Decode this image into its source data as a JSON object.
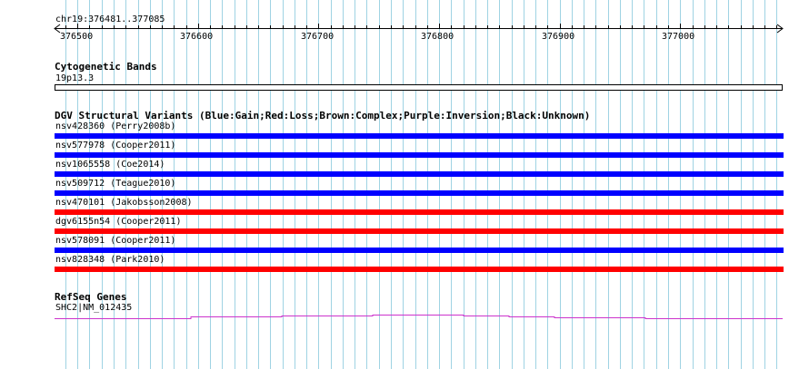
{
  "ruler": {
    "region_label": "chr19:376481..377085",
    "start": 376481,
    "end": 377085,
    "tick_labels": [
      "376500",
      "376600",
      "376700",
      "376800",
      "376900",
      "377000"
    ]
  },
  "tracks": {
    "cytobands": {
      "title": "Cytogenetic Bands",
      "band_label": "19p13.3"
    },
    "dgv": {
      "title": "DGV Structural Variants (Blue:Gain;Red:Loss;Brown:Complex;Purple:Inversion;Black:Unknown)",
      "variants": [
        {
          "label": "nsv428360 (Perry2008b)",
          "type": "gain",
          "color": "#0000ff"
        },
        {
          "label": "nsv577978 (Cooper2011)",
          "type": "gain",
          "color": "#0000ff"
        },
        {
          "label": "nsv1065558 (Coe2014)",
          "type": "gain",
          "color": "#0000ff"
        },
        {
          "label": "nsv509712 (Teague2010)",
          "type": "gain",
          "color": "#0000ff"
        },
        {
          "label": "nsv470101 (Jakobsson2008)",
          "type": "loss",
          "color": "#ff0000"
        },
        {
          "label": "dgv6155n54 (Cooper2011)",
          "type": "loss",
          "color": "#ff0000"
        },
        {
          "label": "nsv578091 (Cooper2011)",
          "type": "gain",
          "color": "#0000ff"
        },
        {
          "label": "nsv828348 (Park2010)",
          "type": "loss",
          "color": "#ff0000"
        }
      ]
    },
    "refseq": {
      "title": "RefSeq Genes",
      "gene_label": "SHC2|NM_012435",
      "gene_color": "#cc33cc"
    }
  },
  "colors": {
    "grid_line": "#9fd3e3",
    "gain": "#0000ff",
    "loss": "#ff0000"
  }
}
